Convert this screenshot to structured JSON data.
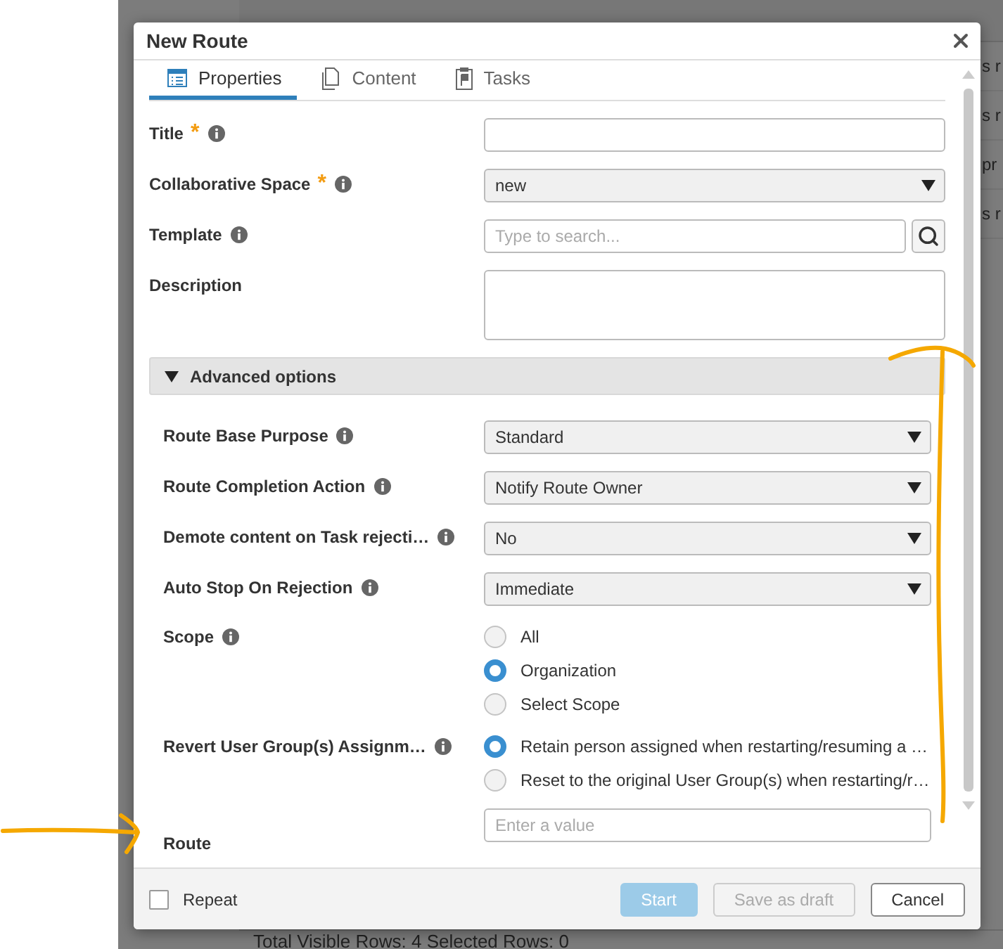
{
  "background_table": {
    "rows": [
      {
        "column_6": "s r"
      },
      {
        "column_6": "s r"
      },
      {
        "column_6": "pr"
      },
      {
        "column_6": "s r"
      }
    ],
    "status_bar": "Total Visible Rows: 4   Selected Rows: 0"
  },
  "dialog": {
    "title": "New Route",
    "tabs": [
      {
        "label": "Properties",
        "kind": "table",
        "selected": true
      },
      {
        "label": "Content",
        "kind": "document",
        "selected": false
      },
      {
        "label": "Tasks",
        "kind": "flag",
        "selected": false
      }
    ],
    "fields": [
      {
        "kind": "text",
        "label": "Title",
        "required_mark": "*",
        "info": true
      },
      {
        "kind": "select",
        "label": "Collaborative Space",
        "required_mark": "*",
        "info": true,
        "value": "new"
      },
      {
        "kind": "search",
        "label": "Template",
        "info": true,
        "placeholder": "Type to search..."
      },
      {
        "kind": "textarea",
        "label": "Description",
        "info": false
      }
    ],
    "advanced": {
      "label": "Advanced options",
      "expanded": true,
      "fields": [
        {
          "kind": "select",
          "label": "Route Base Purpose",
          "info": true,
          "value": "Standard"
        },
        {
          "kind": "select",
          "label": "Route Completion Action",
          "info": true,
          "value": "Notify Route Owner"
        },
        {
          "kind": "select",
          "label": "Demote content on Task rejecti…",
          "info": true,
          "value": "No"
        },
        {
          "kind": "select",
          "label": "Auto Stop On Rejection",
          "info": true,
          "value": "Immediate"
        },
        {
          "kind": "radio",
          "label": "Scope",
          "info": true,
          "options": [
            {
              "label": "All",
              "selected": false
            },
            {
              "label": "Organization",
              "selected": true
            },
            {
              "label": "Select Scope",
              "selected": false
            }
          ]
        },
        {
          "kind": "radio",
          "label": "Revert User Group(s) Assignm…",
          "info": true,
          "options": [
            {
              "label": "Retain person assigned when restarting/resuming a …",
              "selected": true
            },
            {
              "label": "Reset to the original User Group(s) when restarting/r…",
              "selected": false
            }
          ]
        },
        {
          "kind": "text",
          "label": "Route",
          "info": false,
          "placeholder": "Enter a value"
        }
      ]
    },
    "footer": {
      "repeat": {
        "label": "Repeat",
        "checked": false
      },
      "buttons": [
        {
          "label": "Start",
          "kind": "primary",
          "disabled": true
        },
        {
          "label": "Save as draft",
          "kind": "secondary",
          "disabled": true
        },
        {
          "label": "Cancel",
          "kind": "secondary",
          "disabled": false
        }
      ]
    }
  }
}
